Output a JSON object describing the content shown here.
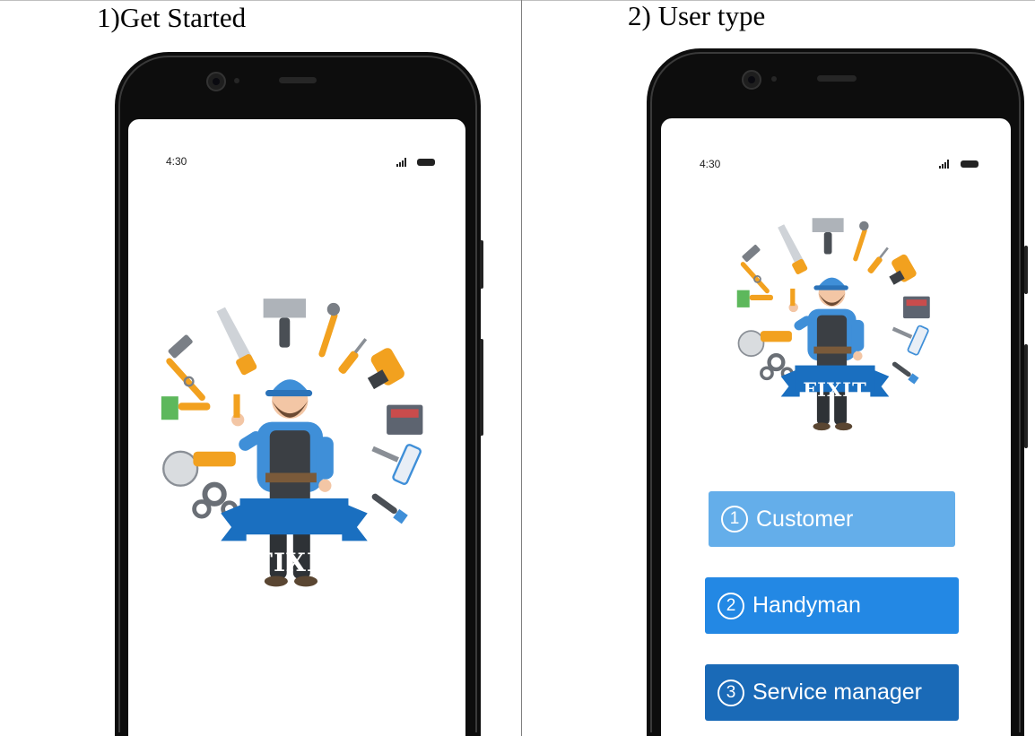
{
  "captions": {
    "left": "1)Get Started",
    "right": "2) User type"
  },
  "left_phone": {
    "status": {
      "time": "4:30",
      "signal_icon": "signal-bars-icon",
      "battery_icon": "battery-icon"
    },
    "logo_text": "FIXIT"
  },
  "right_phone": {
    "status": {
      "time": "4:30",
      "signal_icon": "signal-bars-icon",
      "battery_icon": "battery-icon"
    },
    "logo_text": "FIXIT",
    "options": [
      {
        "num": "1",
        "label": "Customer",
        "color": "#64aeea"
      },
      {
        "num": "2",
        "label": "Handyman",
        "color": "#2388e4"
      },
      {
        "num": "3",
        "label": "Service manager",
        "color": "#1a6ab7"
      }
    ]
  },
  "colors": {
    "banner_blue": "#1a6fc0",
    "tool_orange": "#f2a11f",
    "shirt_blue": "#3f8fd8",
    "overall_dark": "#3b3f44"
  }
}
